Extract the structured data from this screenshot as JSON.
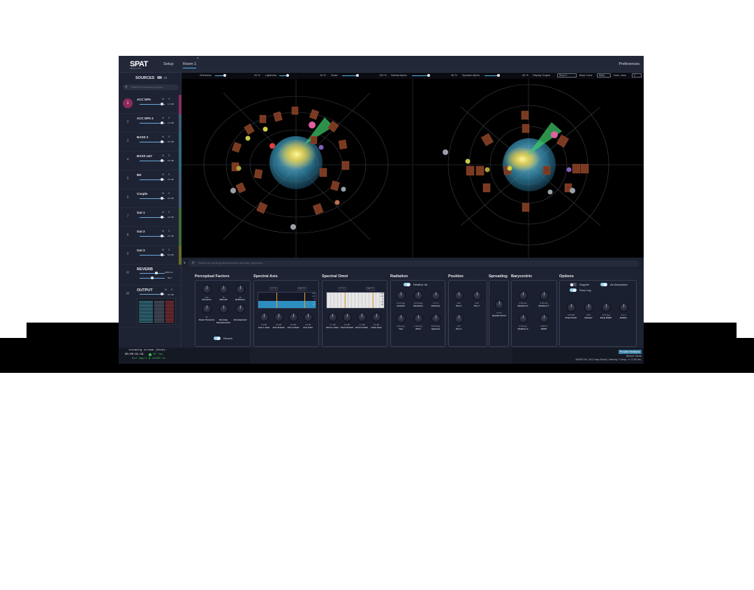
{
  "colors": {
    "accent": "#4fb3e8",
    "selected_source": "#8d2b5c",
    "background": "#1c2130",
    "viewport": "#000000"
  },
  "header": {
    "logo": "SPAT",
    "logo_sub": "REVOLUTION",
    "tabs": [
      {
        "label": "Setup"
      },
      {
        "label": "Room 1",
        "badge": "M"
      }
    ],
    "preferences": "Preferences"
  },
  "sidebar": {
    "title": "SOURCES",
    "all_label": "All",
    "search_placeholder": "Search for sources or groups",
    "sources": [
      {
        "num": "1",
        "name": "ACC DPA",
        "m": "M",
        "s": "S",
        "value": "1.0 dB",
        "color": "#8d2b5c"
      },
      {
        "num": "2",
        "name": "ACC DPA 2",
        "m": "M",
        "s": "S",
        "value": "1.0 dB",
        "color": "#3e5d7a"
      },
      {
        "num": "3",
        "name": "BASS 2",
        "m": "M",
        "s": "S",
        "value": "0.0 dB",
        "color": "#2f6a7a"
      },
      {
        "num": "4",
        "name": "BASS U47",
        "m": "M",
        "s": "S",
        "value": "0.0 dB",
        "color": "#2f6a7a"
      },
      {
        "num": "5",
        "name": "BD",
        "m": "M",
        "s": "S",
        "value": "0.0 dB",
        "color": "#3e5d7a"
      },
      {
        "num": "6",
        "name": "Couple",
        "m": "M",
        "s": "S",
        "value": "0.0 dB",
        "color": "#3e5d7a"
      },
      {
        "num": "7",
        "name": "Gut 1",
        "m": "M",
        "s": "S",
        "value": "0.0 dB",
        "color": "#3d6b3a"
      },
      {
        "num": "8",
        "name": "Gut 2",
        "m": "M",
        "s": "S",
        "value": "0.0 dB",
        "color": "#3d6b3a"
      },
      {
        "num": "9",
        "name": "Gut 3",
        "m": "M",
        "s": "S",
        "value": "5.9 dB",
        "color": "#6a6a2a"
      }
    ],
    "reverb": {
      "num": "R",
      "title": "REVERB",
      "val1": "2500 ms",
      "val2": "60.0"
    },
    "output": {
      "num": "M",
      "title": "OUTPUT",
      "m": "M",
      "s": "S",
      "value": "0.0 dB"
    }
  },
  "viewbar": {
    "shininess_label": "Shininess",
    "shininess_value": "20 %",
    "shininess": 0.2,
    "lightness_label": "Lightness",
    "lightness_value": "15 %",
    "lightness": 0.15,
    "scale_label": "Scale",
    "scale_value": "100 %",
    "scale": 1.0,
    "nebula_label": "Nebula Alpha",
    "nebula_value": "45 %",
    "nebula": 0.45,
    "speaker_label": "Speaker Alpha",
    "speaker_value": "40 %",
    "speaker": 0.4,
    "display_output_label": "Display Output",
    "display_output": "Room 1",
    "back_color_label": "Back Color",
    "back_color": "Black",
    "num_view_label": "Num. view",
    "num_view": "2"
  },
  "main_search": {
    "placeholder": "Search for anything about sources and their properties..."
  },
  "panels": {
    "perceptual": {
      "title": "Perceptual Factors",
      "knobs": [
        {
          "value": "100",
          "label": "Presence"
        },
        {
          "value": "30",
          "label": "Warmth"
        },
        {
          "value": "30",
          "label": "Brilliance"
        },
        {
          "value": "30",
          "label": "Room Presence"
        },
        {
          "value": "",
          "label": "Running Reverberance"
        },
        {
          "value": "",
          "label": "Envelopment"
        }
      ],
      "reverb_label": "Reverb"
    },
    "spectral_axis": {
      "title": "Spectral Axis",
      "freq_low": "177 Hz",
      "freq_high": "5667 Hz",
      "scale": [
        "+24",
        "+12",
        "0",
        "-12",
        "-24"
      ],
      "knobs": [
        {
          "value": "0.0 dB",
          "label": "Axis L-Gain"
        },
        {
          "value": "0.0 dB",
          "label": "Axis M-Gain"
        },
        {
          "value": "0.0 dB",
          "label": "Axis H-Gain"
        },
        {
          "value": "0.0 dB",
          "label": "Axis Gain"
        }
      ]
    },
    "spectral_omni": {
      "title": "Spectral Omni",
      "freq_low": "177 Hz",
      "freq_high": "5667 Hz",
      "scale": [
        "+24",
        "+12",
        "0",
        "-12",
        "-24"
      ],
      "knobs": [
        {
          "value": "-1.7 dB",
          "label": "Omni L-Gain"
        },
        {
          "value": "0.0 dB",
          "label": "Omni M-Gain"
        },
        {
          "value": "-1.0 dB",
          "label": "Omni H-Gain"
        },
        {
          "value": "0.0 dB",
          "label": "Omni Gain"
        }
      ]
    },
    "radiation": {
      "title": "Radiation",
      "relative_label": "Relative dir.",
      "knobs": [
        {
          "value": "11.45 deg",
          "label": "Azimuth"
        },
        {
          "value": "31.32 deg",
          "label": "Elevation"
        },
        {
          "value": "1.74 m",
          "label": "Distance"
        },
        {
          "value": "0.00 deg",
          "label": "Yaw"
        },
        {
          "value": "0.00 deg",
          "label": "Pitch"
        },
        {
          "value": "90.00 deg",
          "label": "Aperture"
        }
      ]
    },
    "position": {
      "title": "Position",
      "knobs": [
        {
          "value": "1.00",
          "label": "Pos X"
        },
        {
          "value": "0.35",
          "label": "Pos Y"
        },
        {
          "value": "1.27",
          "label": "Pos Z"
        }
      ]
    },
    "spreading": {
      "title": "Spreading",
      "knobs": [
        {
          "value": "0.0 %",
          "label": "Spread Factor"
        }
      ]
    },
    "barycentric": {
      "title": "Barycentric",
      "knobs": [
        {
          "value": "0.00 deg",
          "label": "Rotation X"
        },
        {
          "value": "0.00 deg",
          "label": "Rotation Y"
        },
        {
          "value": "0.00 deg",
          "label": "Rotation Z"
        },
        {
          "value": "1.000 %",
          "label": "Width"
        }
      ]
    },
    "options": {
      "title": "Options",
      "doppler_label": "Doppler",
      "air_label": "Air Absorption",
      "drop_log_label": "Drop Log",
      "knobs": [
        {
          "value": "0.00 dB",
          "label": "Drop Factor"
        },
        {
          "value": "0.00",
          "label": "Hauteur"
        },
        {
          "value": "10.0 deg",
          "label": "Early Width"
        },
        {
          "value": "1.0 m",
          "label": "Radius"
        }
      ]
    }
  },
  "footer": {
    "stream_label": "incoming stream (Send):",
    "timecode": "00:00:31:19",
    "fps": "25 fps",
    "rate": "512 smp/s @ 44100 Hz",
    "feedback": "Provide feedback",
    "device": "device: None",
    "status": "48000 Hz | 512 smp./block | latency: 0 smp. <= 0.00 ms."
  }
}
